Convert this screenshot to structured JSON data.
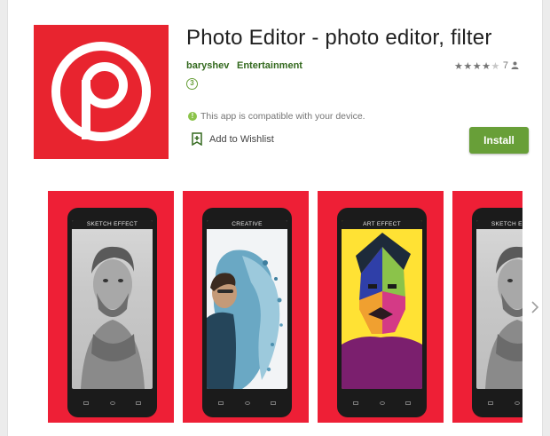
{
  "app": {
    "title": "Photo Editor - photo editor, filter",
    "developer": "baryshev",
    "category": "Entertainment",
    "rating_stars": 3.5,
    "rating_count": "7",
    "content_rating": "3",
    "compatibility": "This app is compatible with your device.",
    "wishlist_label": "Add to Wishlist",
    "install_label": "Install",
    "icon": "p-logo-icon"
  },
  "screenshots": [
    {
      "label": "SKETCH EFFECT",
      "image": "sketch-portrait"
    },
    {
      "label": "CREATIVE",
      "image": "dispersion-portrait"
    },
    {
      "label": "ART EFFECT",
      "image": "pop-art-portrait"
    },
    {
      "label": "SKETCH EFFECT",
      "image": "sketch-portrait"
    }
  ],
  "colors": {
    "brand_red": "#e8242f",
    "accent_green": "#689f38",
    "developer_green": "#33691e"
  }
}
